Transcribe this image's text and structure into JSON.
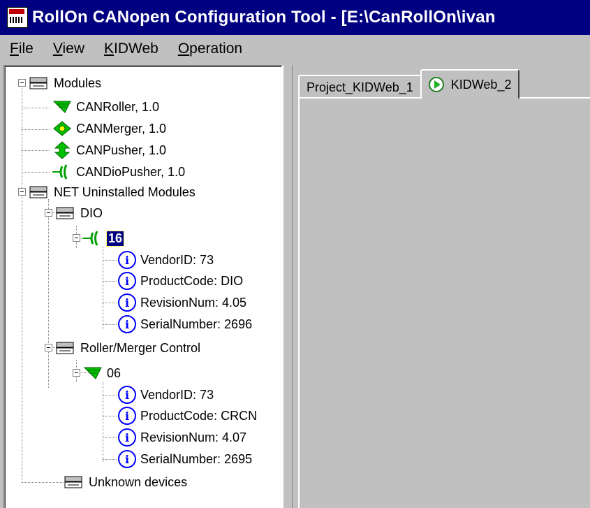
{
  "window": {
    "title": "RollOn CANopen Configuration Tool - [E:\\CanRollOn\\ivan"
  },
  "menu": [
    {
      "label": "File",
      "accel": "F",
      "rest": "ile"
    },
    {
      "label": "View",
      "accel": "V",
      "rest": "iew"
    },
    {
      "label": "KIDWeb",
      "accel": "K",
      "rest": "IDWeb"
    },
    {
      "label": "Operation",
      "accel": "O",
      "rest": "peration"
    }
  ],
  "tree": {
    "modules": "Modules",
    "canroller": "CANRoller, 1.0",
    "canmerger": "CANMerger, 1.0",
    "canpusher": "CANPusher, 1.0",
    "candiopusher": "CANDioPusher, 1.0",
    "net_uninstalled": "NET Uninstalled Modules",
    "dio": "DIO",
    "dio_node": "16",
    "dio_vendor": "VendorID: 73",
    "dio_product": "ProductCode: DIO",
    "dio_revision": "RevisionNum: 4.05",
    "dio_serial": "SerialNumber: 2696",
    "roller_merger": "Roller/Merger Control",
    "rm_node": "06",
    "rm_vendor": "VendorID: 73",
    "rm_product": "ProductCode: CRCN",
    "rm_revision": "RevisionNum: 4.07",
    "rm_serial": "SerialNumber: 2695",
    "unknown": "Unknown devices",
    "info_glyph": "i"
  },
  "tabs": [
    {
      "label": "Project_KIDWeb_1",
      "active": false
    },
    {
      "label": "KIDWeb_2",
      "active": true
    }
  ],
  "colors": {
    "title_bar": "#000080",
    "info_icon": "#0000ff",
    "module_icon_green": "#00a000",
    "selection": "#000080"
  }
}
